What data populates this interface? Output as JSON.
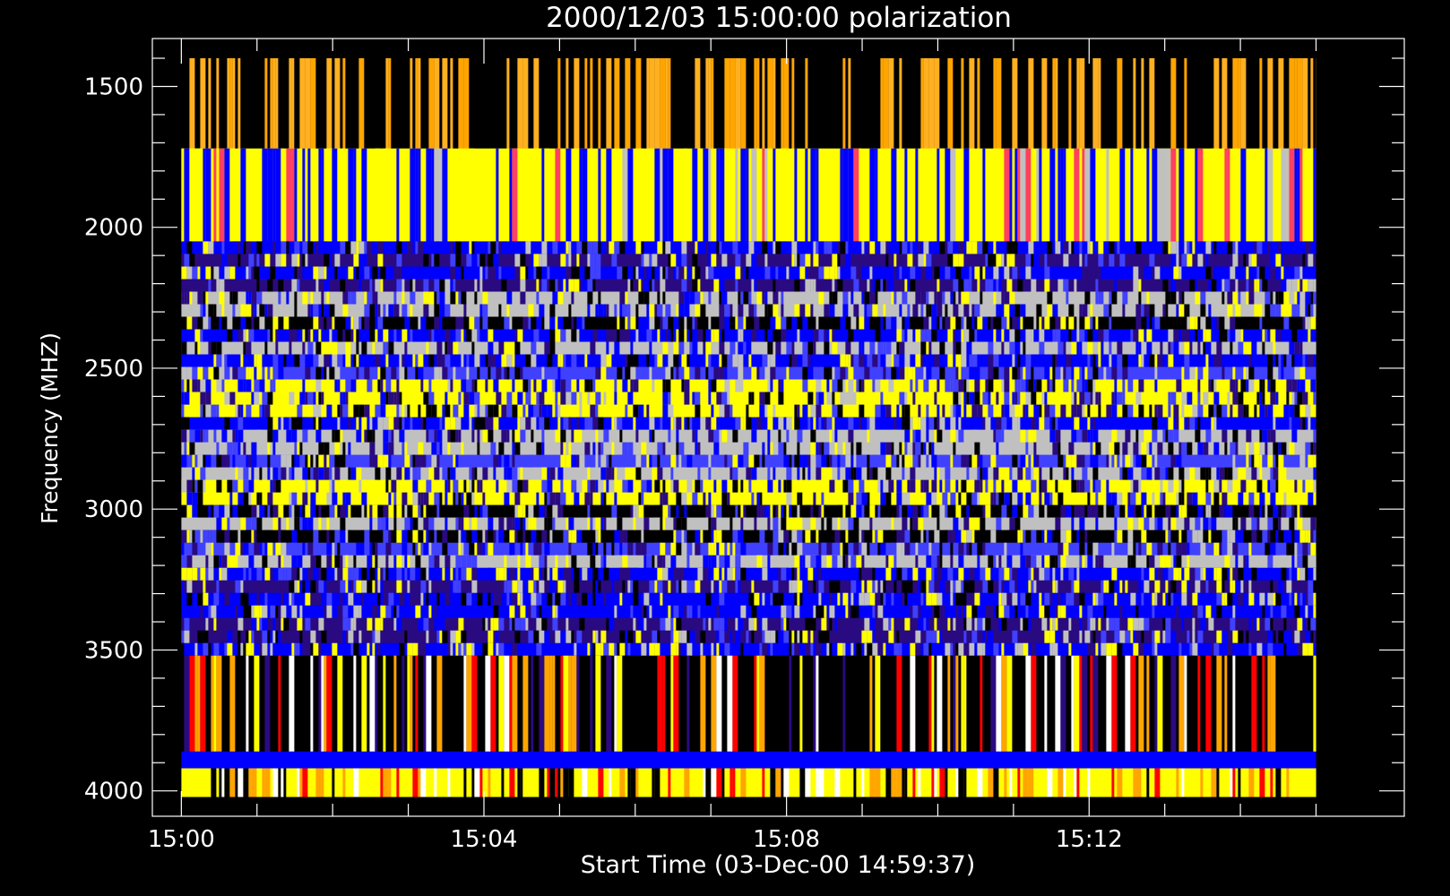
{
  "chart_data": {
    "type": "heatmap",
    "title": "2000/12/03 15:00:00 polarization",
    "xlabel": "Start Time (03-Dec-00 14:59:37)",
    "ylabel": "Frequency (MHZ)",
    "x_range": [
      "15:00",
      "15:15"
    ],
    "xlim": [
      "14:59:37",
      "15:16:10"
    ],
    "y_range": [
      1400,
      4020
    ],
    "ylim": [
      1330,
      4090
    ],
    "x_ticks": [
      "15:00",
      "15:04",
      "15:08",
      "15:12"
    ],
    "y_ticks": [
      1500,
      2000,
      2500,
      3000,
      3500,
      4000
    ],
    "y_axis_inverted": true,
    "grid": false,
    "background": "#000000",
    "axis_color": "#ffffff",
    "colormap": [
      "#000000",
      "#2a0a80",
      "#0000ff",
      "#4040ff",
      "#c0c0c0",
      "#ffff00",
      "#ff0000",
      "#ffa500",
      "#ffffff"
    ],
    "bands": [
      {
        "from": 1400,
        "to": 1720,
        "colors": [
          "#ffa500",
          "#000000",
          "#ffb020"
        ]
      },
      {
        "from": 1720,
        "to": 2050,
        "colors": [
          "#0000ff",
          "#0000ff",
          "#0000ff",
          "#ffff00",
          "#ff4060",
          "#c0c0c0"
        ]
      },
      {
        "from": 2050,
        "to": 3520,
        "colors": [
          "#0000ff",
          "#2a0a80",
          "#ffff00",
          "#c0c0c0",
          "#000000",
          "#4040ff"
        ]
      },
      {
        "from": 3520,
        "to": 3860,
        "colors": [
          "#ff0000",
          "#ffff00",
          "#000000",
          "#2a0a80",
          "#ffa500",
          "#ffffff"
        ]
      },
      {
        "from": 3860,
        "to": 3920,
        "colors": [
          "#0000ff"
        ]
      },
      {
        "from": 3920,
        "to": 4020,
        "colors": [
          "#ffffff",
          "#ffa500",
          "#000000",
          "#ff0000",
          "#ffff00"
        ]
      }
    ]
  }
}
